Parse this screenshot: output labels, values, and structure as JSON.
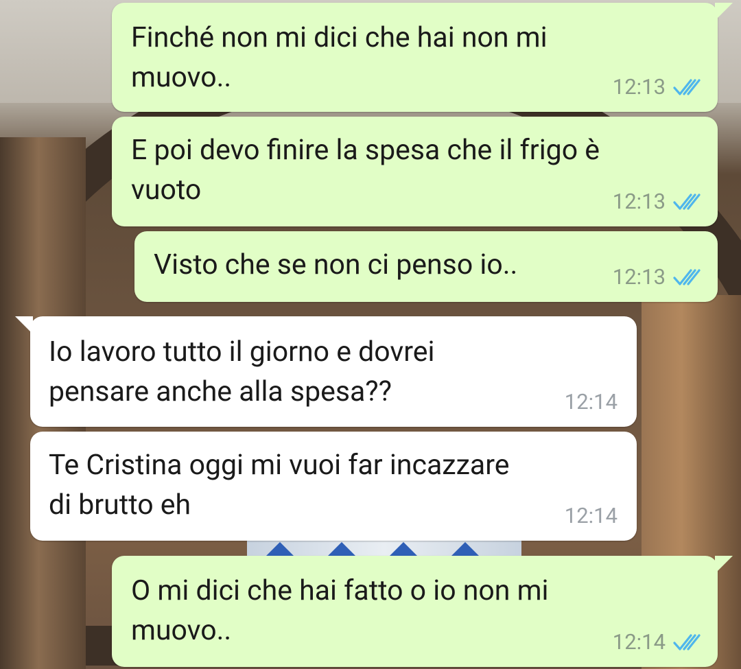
{
  "messages": [
    {
      "direction": "out",
      "text": "Finché non mi dici che hai non mi\nmuovo..",
      "time": "12:13",
      "status": "read"
    },
    {
      "direction": "out",
      "text": "E poi devo finire la spesa che il frigo è\nvuoto",
      "time": "12:13",
      "status": "read"
    },
    {
      "direction": "out",
      "text": "Visto che se non ci penso io..",
      "time": "12:13",
      "status": "read"
    },
    {
      "direction": "in",
      "text": "Io lavoro tutto il giorno e dovrei\npensare anche alla spesa??",
      "time": "12:14"
    },
    {
      "direction": "in",
      "text": "Te Cristina oggi mi vuoi far incazzare\ndi brutto eh",
      "time": "12:14"
    },
    {
      "direction": "out",
      "text": "O mi dici che hai fatto o io non mi\nmuovo..",
      "time": "12:14",
      "status": "read"
    }
  ],
  "colors": {
    "outgoing_bubble": "#e1fec6",
    "incoming_bubble": "#ffffff",
    "read_tick": "#4fb6ec"
  },
  "icons": {
    "read_status": "double-check-icon"
  }
}
